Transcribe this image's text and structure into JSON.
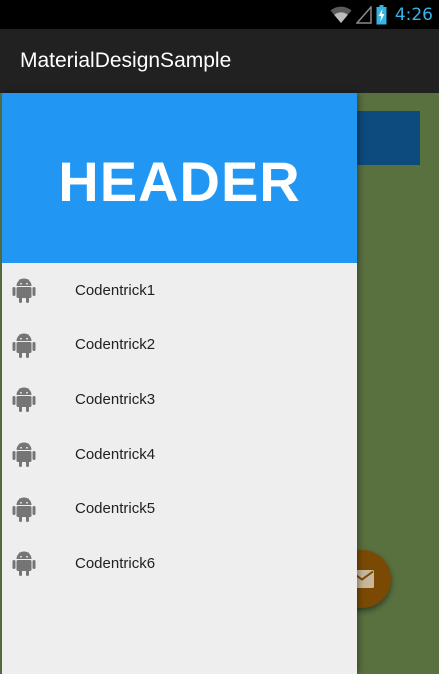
{
  "status_bar": {
    "time": "4:26",
    "icons": [
      "wifi-icon",
      "signal-icon",
      "battery-charging-icon"
    ],
    "time_color": "#33b5e5"
  },
  "action_bar": {
    "title": "MaterialDesignSample",
    "background": "#212121"
  },
  "drawer": {
    "header_text": "HEADER",
    "header_color": "#2196f3",
    "background": "#eeeeee",
    "items": [
      {
        "label": "Codentrick1",
        "icon": "android-icon"
      },
      {
        "label": "Codentrick2",
        "icon": "android-icon"
      },
      {
        "label": "Codentrick3",
        "icon": "android-icon"
      },
      {
        "label": "Codentrick4",
        "icon": "android-icon"
      },
      {
        "label": "Codentrick5",
        "icon": "android-icon"
      },
      {
        "label": "Codentrick6",
        "icon": "android-icon"
      }
    ]
  },
  "content": {
    "background": "#59703f",
    "fab_icon": "mail-icon",
    "fab_color": "#7a4a05"
  }
}
